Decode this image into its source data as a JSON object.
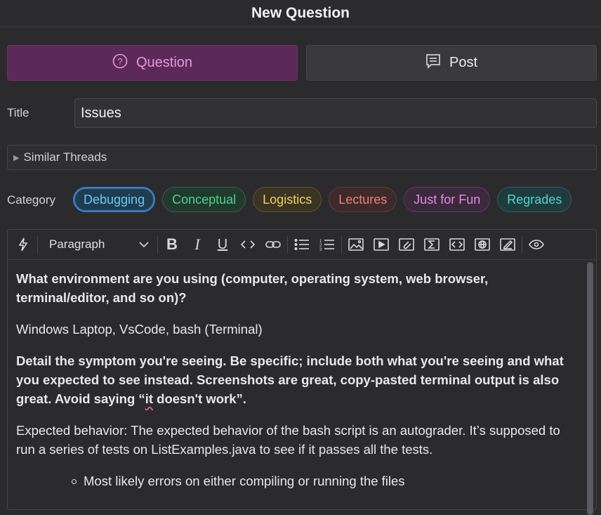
{
  "header": {
    "title": "New Question"
  },
  "post_type": {
    "question_label": "Question",
    "post_label": "Post"
  },
  "title_field": {
    "label": "Title",
    "value": "Issues"
  },
  "similar_threads": {
    "label": "Similar Threads"
  },
  "category": {
    "label": "Category",
    "options": [
      {
        "label": "Debugging",
        "color": "#6cc7ef",
        "bg": "#1f3d50",
        "border": "#3f6e8a",
        "selected": true
      },
      {
        "label": "Conceptual",
        "color": "#4fd28a",
        "bg": "#203a2e",
        "border": "#3a5d48"
      },
      {
        "label": "Logistics",
        "color": "#f0d060",
        "bg": "#3a3522",
        "border": "#5b5232"
      },
      {
        "label": "Lectures",
        "color": "#f08070",
        "bg": "#3e2a2a",
        "border": "#5e3d3a"
      },
      {
        "label": "Just for Fun",
        "color": "#e48ae0",
        "bg": "#3a2a3c",
        "border": "#5a3f5c"
      },
      {
        "label": "Regrades",
        "color": "#4ed6d0",
        "bg": "#203b3c",
        "border": "#365c5c"
      }
    ]
  },
  "editor": {
    "paragraph_label": "Paragraph",
    "content": {
      "q1": "What environment are you using (computer, operating system, web browser, terminal/editor, and so on)?",
      "a1": "Windows Laptop, VsCode, bash (Terminal)",
      "q2_before": "Detail the symptom you're seeing. Be specific; include both what you're seeing and what you expected to see instead. Screenshots are great, copy-pasted terminal output is also great. Avoid saying “",
      "q2_word": "it",
      "q2_after": " doesn't work”.",
      "a2": "Expected behavior: The expected behavior of the bash script is an autograder. It’s supposed to run a series of tests on ListExamples.java to see if it passes all the tests.",
      "bullet1": "Most likely errors on either compiling or running the files"
    }
  }
}
